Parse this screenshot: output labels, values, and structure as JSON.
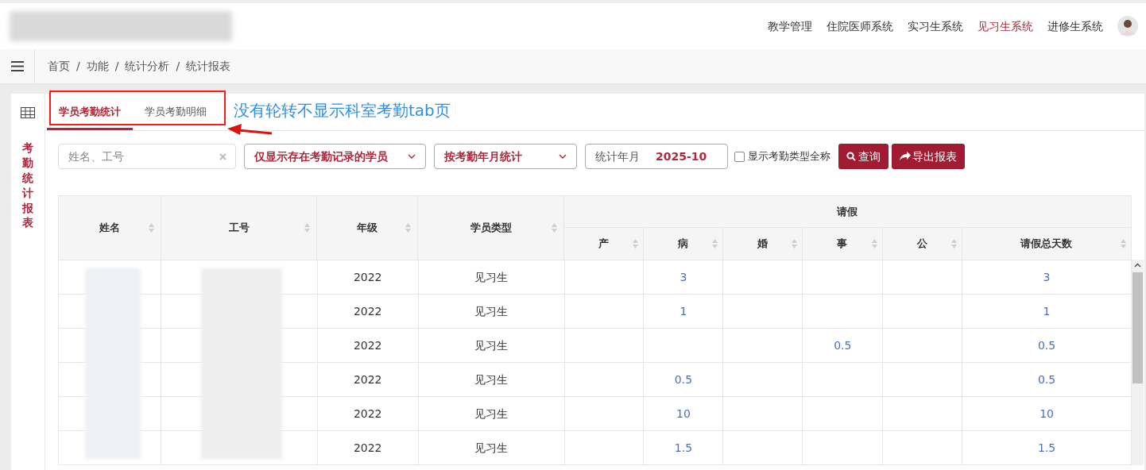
{
  "top_nav": {
    "items": [
      {
        "label": "教学管理",
        "selected": false
      },
      {
        "label": "住院医师系统",
        "selected": false
      },
      {
        "label": "实习生系统",
        "selected": false
      },
      {
        "label": "见习生系统",
        "selected": true
      },
      {
        "label": "进修生系统",
        "selected": false
      }
    ]
  },
  "breadcrumb": [
    {
      "label": "首页"
    },
    {
      "separator": "/",
      "label": "功能"
    },
    {
      "separator": "/",
      "label": "统计分析"
    },
    {
      "separator": "/",
      "label": "统计报表"
    }
  ],
  "side_title": "考勤统计报表",
  "tabs": [
    {
      "label": "学员考勤统计",
      "selected": true
    },
    {
      "label": "学员考勤明细",
      "selected": false
    }
  ],
  "annotation": {
    "text": "没有轮转不显示科室考勤tab页"
  },
  "filters": {
    "search": {
      "placeholder": "姓名、工号"
    },
    "scope_select": "仅显示存在考勤记录的学员",
    "mode_select": "按考勤年月统计",
    "month": {
      "label": "统计年月",
      "value": "2025-10"
    },
    "full_name_checkbox": {
      "label": "显示考勤类型全称",
      "checked": false
    },
    "buttons": [
      "查询",
      "导出报表"
    ]
  },
  "table": {
    "columns": [
      "姓名",
      "工号",
      "年级",
      "学员类型"
    ],
    "group_header": "请假",
    "leave_columns": [
      {
        "kind": "maternity",
        "label": "产"
      },
      {
        "kind": "sick",
        "label": "病"
      },
      {
        "kind": "marriage",
        "label": "婚"
      },
      {
        "kind": "personal",
        "label": "事"
      },
      {
        "kind": "official",
        "label": "公"
      },
      {
        "kind": "total",
        "label": "请假总天数"
      }
    ],
    "rows": [
      {
        "grade": "2022",
        "type": "见习生",
        "values": {
          "sick": "3",
          "total": "3"
        }
      },
      {
        "grade": "2022",
        "type": "见习生",
        "values": {
          "sick": "1",
          "total": "1"
        }
      },
      {
        "grade": "2022",
        "type": "见习生",
        "values": {
          "personal": "0.5",
          "total": "0.5"
        }
      },
      {
        "grade": "2022",
        "type": "见习生",
        "values": {
          "sick": "0.5",
          "total": "0.5"
        }
      },
      {
        "grade": "2022",
        "type": "见习生",
        "values": {
          "sick": "10",
          "total": "10"
        }
      },
      {
        "grade": "2022",
        "type": "见习生",
        "values": {
          "sick": "1.5",
          "total": "1.5"
        }
      }
    ]
  }
}
